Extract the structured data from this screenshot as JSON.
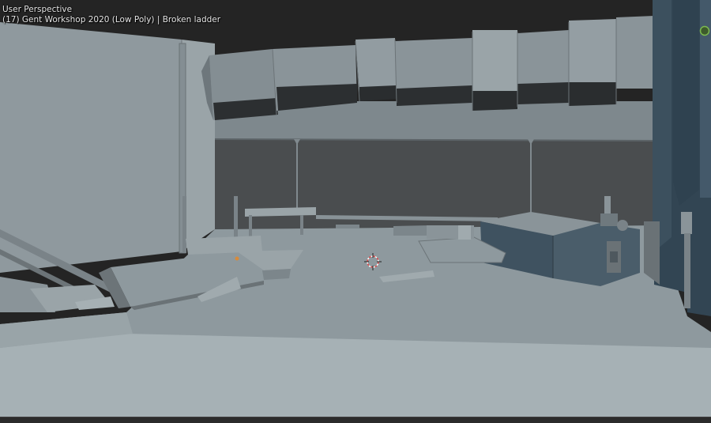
{
  "viewport": {
    "view_mode": "User Perspective",
    "object_info": "(17) Gent Workshop 2020 (Low Poly) | Broken ladder"
  },
  "colors": {
    "void": "#242424",
    "floor": "#8e999e",
    "floor_near": "#a7b2b6",
    "wall_light": "#8f999e",
    "wall_dark": "#4a4d4f",
    "duct": "#848e93",
    "duct_shadow": "#2a2d2f",
    "machine_dark": "#3f5260",
    "gizmo_green": "#5c9a3a"
  },
  "icons": {
    "cursor": "3d-cursor-icon",
    "gizmo": "navigation-gizmo-icon"
  }
}
